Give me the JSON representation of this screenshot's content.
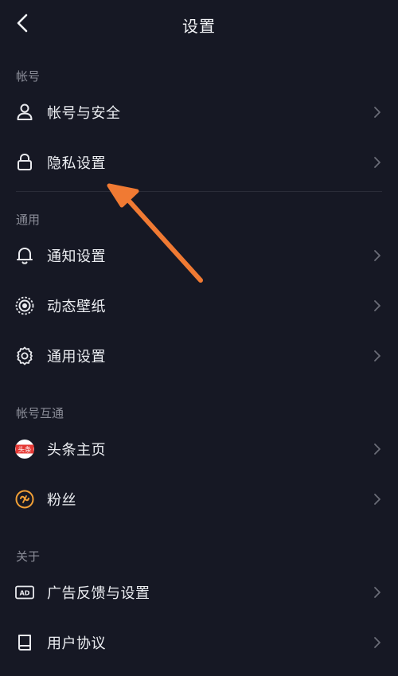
{
  "header": {
    "title": "设置",
    "back_icon": "back-chevron-icon"
  },
  "sections": {
    "account": {
      "label": "帐号",
      "items": [
        {
          "label": "帐号与安全",
          "icon": "user-icon"
        },
        {
          "label": "隐私设置",
          "icon": "lock-icon"
        }
      ]
    },
    "general": {
      "label": "通用",
      "items": [
        {
          "label": "通知设置",
          "icon": "bell-icon"
        },
        {
          "label": "动态壁纸",
          "icon": "live-wallpaper-icon"
        },
        {
          "label": "通用设置",
          "icon": "gear-icon"
        }
      ]
    },
    "linked": {
      "label": "帐号互通",
      "items": [
        {
          "label": "头条主页",
          "icon": "toutiao-icon",
          "badge": "头条"
        },
        {
          "label": "粉丝",
          "icon": "fans-icon"
        }
      ]
    },
    "about": {
      "label": "关于",
      "items": [
        {
          "label": "广告反馈与设置",
          "icon": "ad-icon",
          "badge": "AD"
        },
        {
          "label": "用户协议",
          "icon": "book-icon"
        }
      ]
    }
  },
  "colors": {
    "background": "#161824",
    "annotation_arrow": "#f07a33",
    "toutiao_red": "#e53935",
    "fans_orange": "#f2a036"
  }
}
